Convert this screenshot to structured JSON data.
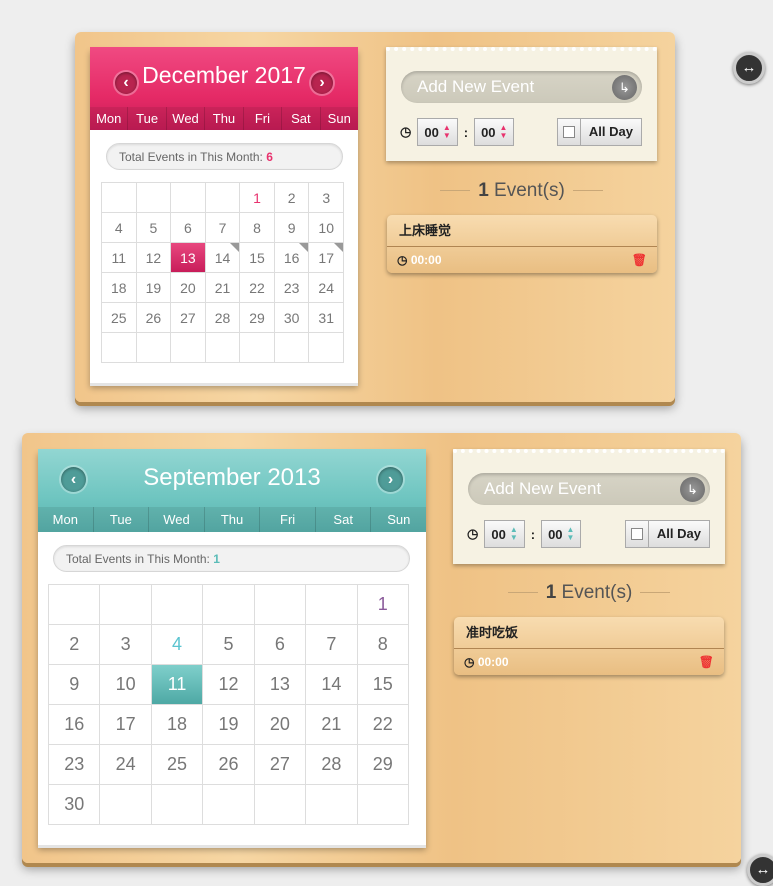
{
  "widgets": [
    {
      "month": "December 2017",
      "accent": "#e8326e",
      "weekdays": [
        "Mon",
        "Tue",
        "Wed",
        "Thu",
        "Fri",
        "Sat",
        "Sun"
      ],
      "total_label": "Total Events in This Month:",
      "total_count": "6",
      "days": [
        "",
        "",
        "",
        "",
        "1",
        "2",
        "3",
        "4",
        "5",
        "6",
        "7",
        "8",
        "9",
        "10",
        "11",
        "12",
        "13",
        "14",
        "15",
        "16",
        "17",
        "18",
        "19",
        "20",
        "21",
        "22",
        "23",
        "24",
        "25",
        "26",
        "27",
        "28",
        "29",
        "30",
        "31",
        "",
        "",
        "",
        "",
        "",
        "",
        ""
      ],
      "selected": "13",
      "marked": [
        "14",
        "16",
        "17"
      ],
      "highlight": {
        "1": "#e8326e"
      },
      "add_placeholder": "Add New Event",
      "hour": "00",
      "minute": "00",
      "allday_label": "All Day",
      "event_count": "1",
      "event_count_label": "Event(s)",
      "events": [
        {
          "name": "上床睡觉",
          "time": "00:00"
        }
      ]
    },
    {
      "month": "September 2013",
      "accent": "#5bbcb8",
      "weekdays": [
        "Mon",
        "Tue",
        "Wed",
        "Thu",
        "Fri",
        "Sat",
        "Sun"
      ],
      "total_label": "Total Events in This Month:",
      "total_count": "1",
      "days": [
        "",
        "",
        "",
        "",
        "",
        "",
        "1",
        "2",
        "3",
        "4",
        "5",
        "6",
        "7",
        "8",
        "9",
        "10",
        "11",
        "12",
        "13",
        "14",
        "15",
        "16",
        "17",
        "18",
        "19",
        "20",
        "21",
        "22",
        "23",
        "24",
        "25",
        "26",
        "27",
        "28",
        "29",
        "30",
        "",
        "",
        "",
        "",
        "",
        ""
      ],
      "selected": "11",
      "marked": [],
      "highlight": {
        "4": "#5bc4d0",
        "1": "#8a5a9a"
      },
      "add_placeholder": "Add New Event",
      "hour": "00",
      "minute": "00",
      "allday_label": "All Day",
      "event_count": "1",
      "event_count_label": "Event(s)",
      "events": [
        {
          "name": "准时吃饭",
          "time": "00:00"
        }
      ]
    }
  ]
}
